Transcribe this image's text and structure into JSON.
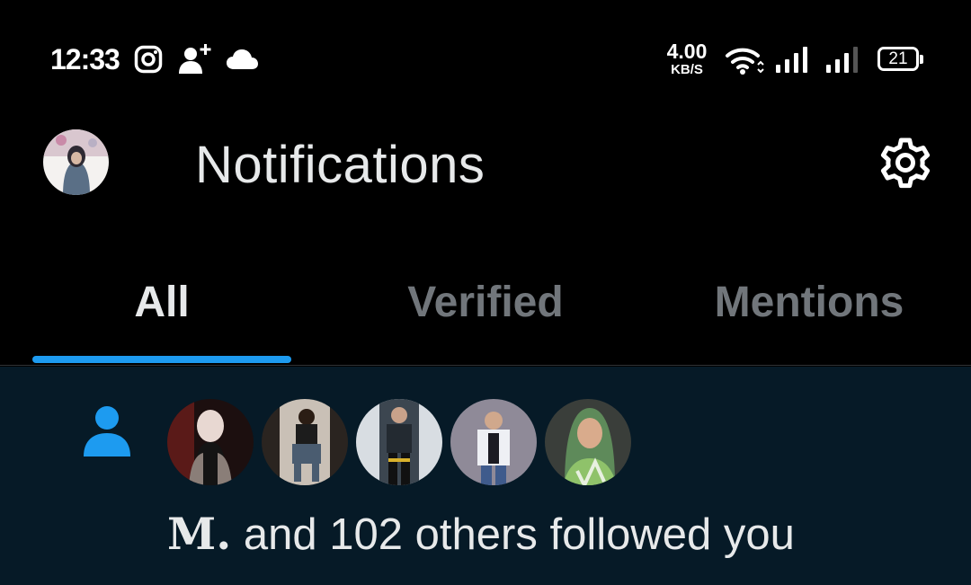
{
  "status_bar": {
    "time": "12:33",
    "net_speed_value": "4.00",
    "net_speed_unit": "KB/S",
    "battery_level": "21",
    "icons": [
      "instagram-icon",
      "person-add-icon",
      "cloud-icon",
      "wifi-icon",
      "signal-icon",
      "signal-icon",
      "battery-icon"
    ]
  },
  "header": {
    "title": "Notifications",
    "avatar_icon": "avatar",
    "settings_icon": "gear-icon"
  },
  "tabs": [
    {
      "label": "All",
      "active": true
    },
    {
      "label": "Verified",
      "active": false
    },
    {
      "label": "Mentions",
      "active": false
    }
  ],
  "notification": {
    "type_icon": "person-icon",
    "name": "M.",
    "rest": " and 102 others followed you"
  },
  "colors": {
    "accent": "#1d9bf0",
    "background": "#000000",
    "highlight_background": "#061a27",
    "inactive_text": "#71767b",
    "text": "#e7e9ea"
  }
}
